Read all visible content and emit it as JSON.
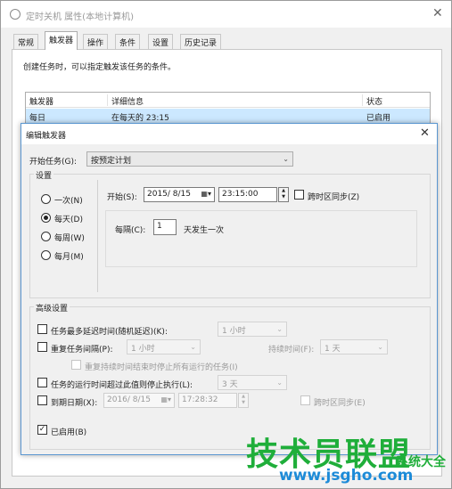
{
  "background_window": {
    "title": "定时关机 属性(本地计算机)",
    "tabs": [
      "常规",
      "触发器",
      "操作",
      "条件",
      "设置",
      "历史记录"
    ],
    "active_tab": "触发器",
    "description": "创建任务时，可以指定触发该任务的条件。",
    "list": {
      "columns": [
        "触发器",
        "详细信息",
        "状态"
      ],
      "rows": [
        [
          "每日",
          "在每天的 23:15",
          "已启用"
        ]
      ]
    }
  },
  "dialog": {
    "title": "编辑触发器",
    "begin_task_label": "开始任务(G):",
    "begin_task_value": "按预定计划",
    "settings_group_label": "设置",
    "schedule_options": [
      "一次(N)",
      "每天(D)",
      "每周(W)",
      "每月(M)"
    ],
    "selected_schedule": "每天(D)",
    "start_label": "开始(S):",
    "start_date": "2015/ 8/15",
    "start_time": "23:15:00",
    "sync_timezone_label": "跨时区同步(Z)",
    "every_label": "每隔(C):",
    "every_value": "1",
    "every_unit": "天发生一次",
    "advanced_group_label": "高级设置",
    "delay_label": "任务最多延迟时间(随机延迟)(K):",
    "delay_value": "1 小时",
    "repeat_label": "重复任务间隔(P):",
    "repeat_value": "1 小时",
    "duration_label": "持续时间(F):",
    "duration_value": "1 天",
    "stop_repeat_label": "重复持续时间结束时停止所有运行的任务(I)",
    "stop_longer_label": "任务的运行时间超过此值则停止执行(L):",
    "stop_longer_value": "3 天",
    "expire_label": "到期日期(X):",
    "expire_date": "2016/ 8/15",
    "expire_time": "17:28:32",
    "expire_sync_label": "跨时区同步(E)",
    "enabled_label": "已启用(B)"
  },
  "watermark": {
    "main": "技术员联盟",
    "url": "www.jsgho.com",
    "side": "系统大全"
  },
  "colors": {
    "watermark_main": "#1fae3a",
    "watermark_url": "#1d8bd8",
    "selected_row": "#cce8ff",
    "dialog_border": "#5b97d1"
  }
}
